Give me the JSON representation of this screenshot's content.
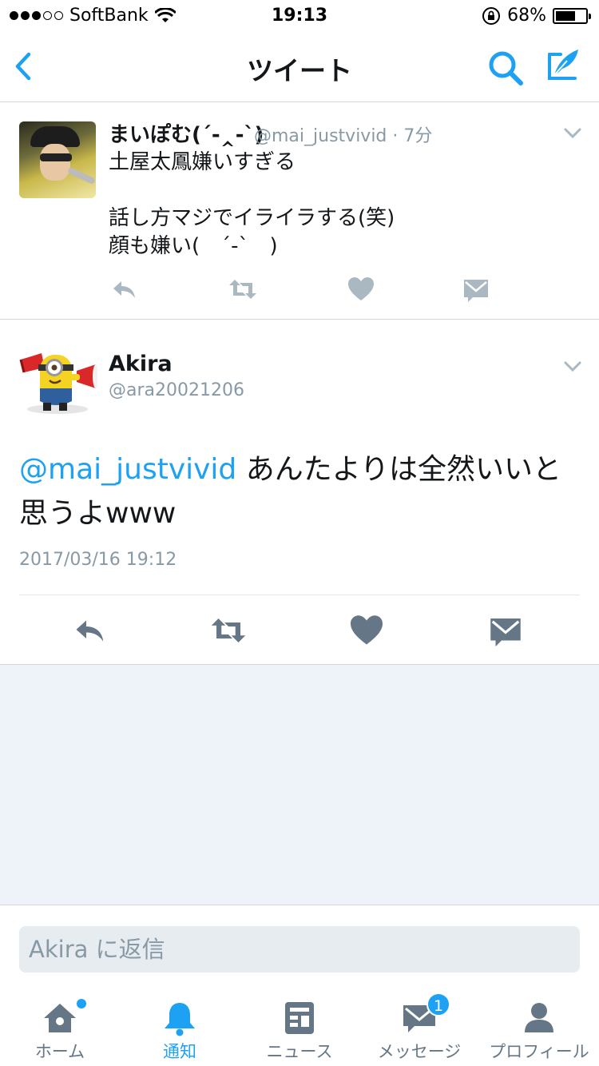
{
  "status_bar": {
    "carrier": "SoftBank",
    "time": "19:13",
    "battery": "68%",
    "battery_level": 0.68
  },
  "nav": {
    "title": "ツイート",
    "back_icon": "chevron-left-icon",
    "search_icon": "search-icon",
    "compose_icon": "compose-icon"
  },
  "tweet_parent": {
    "name": "まいぽむ(´-‸-`)",
    "handle_time": "@mai_justvivid · 7分",
    "text": "土屋太鳳嫌いすぎる\n\n話し方マジでイライラする(笑)\n顔も嫌い(　´-`　)"
  },
  "tweet_main": {
    "name": "Akira",
    "handle": "@ara20021206",
    "mention": "@mai_justvivid",
    "text": " あんたよりは全然いいと思うよwww",
    "timestamp": "2017/03/16 19:12"
  },
  "reply": {
    "placeholder": "Akira に返信"
  },
  "tabs": [
    {
      "label": "ホーム",
      "icon": "home-icon"
    },
    {
      "label": "通知",
      "icon": "bell-icon"
    },
    {
      "label": "ニュース",
      "icon": "news-icon"
    },
    {
      "label": "メッセージ",
      "icon": "message-icon",
      "badge": "1"
    },
    {
      "label": "プロフィール",
      "icon": "profile-icon"
    }
  ],
  "colors": {
    "accent": "#1da1f2",
    "secondary_text": "#8899a6",
    "icon_gray": "#657786",
    "background": "#eef3f9"
  }
}
